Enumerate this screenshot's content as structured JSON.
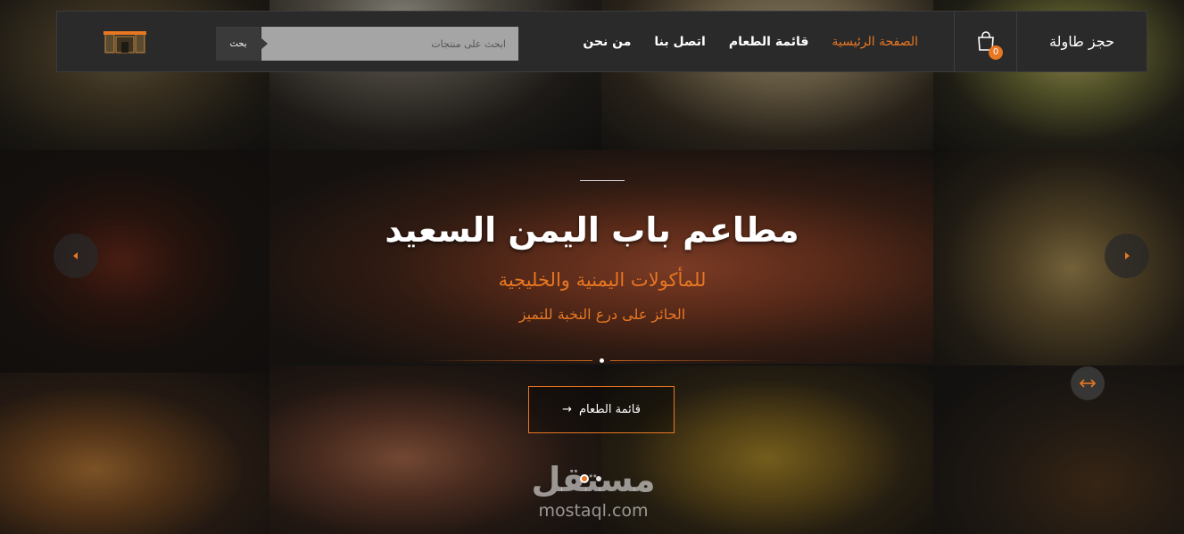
{
  "header": {
    "booking_label": "حجز طاولة",
    "cart_count": "0",
    "nav": [
      {
        "label": "الصفحة الرئيسية",
        "active": true
      },
      {
        "label": "قائمة الطعام",
        "active": false
      },
      {
        "label": "اتصل بنا",
        "active": false
      },
      {
        "label": "من نحن",
        "active": false
      }
    ],
    "search": {
      "placeholder": "ابحث على منتجات",
      "button_label": "بحث"
    }
  },
  "hero": {
    "title": "مطاعم باب اليمن السعيد",
    "subtitle": "للمأكولات اليمنية والخليجية",
    "tagline": "الحائز على درع النخبة للتميز",
    "menu_button_label": "قائمة الطعام",
    "menu_button_arrow": "→"
  },
  "slider": {
    "total_slides": 2,
    "active_slide": 1
  },
  "watermark": {
    "arabic": "مستقل",
    "latin": "mostaql.com"
  },
  "colors": {
    "accent": "#e87722",
    "header_bg": "#2a2a2a",
    "text": "#ffffff"
  },
  "icons": [
    "shopping-bag-icon",
    "search-icon",
    "chevron-left-icon",
    "chevron-right-icon",
    "swap-arrows-icon",
    "arrow-right-icon"
  ]
}
